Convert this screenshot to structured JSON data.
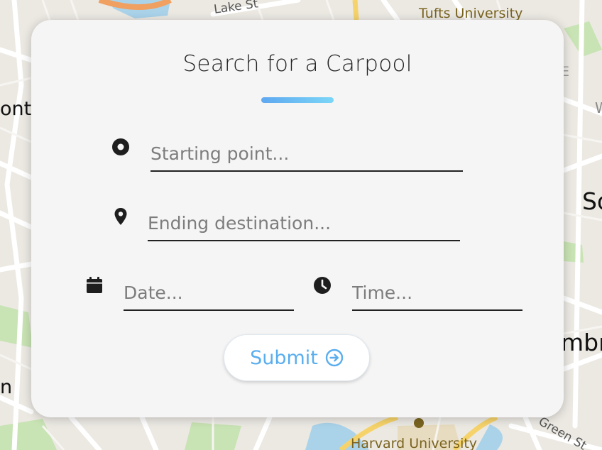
{
  "map": {
    "labels": {
      "tufts": "Tufts University",
      "lake_st": "Lake St",
      "ont": "ont",
      "so": "So",
      "mbr": "mbr",
      "n": "n",
      "w": "W",
      "e": "E",
      "harvard": "Harvard University",
      "green_st": "Green St"
    }
  },
  "form": {
    "title": "Search for a Carpool",
    "start": {
      "placeholder": "Starting point...",
      "icon": "radio-target-icon"
    },
    "end": {
      "placeholder": "Ending destination...",
      "icon": "map-pin-icon"
    },
    "date": {
      "placeholder": "Date...",
      "icon": "calendar-icon"
    },
    "time": {
      "placeholder": "Time...",
      "icon": "clock-icon"
    },
    "submit": {
      "label": "Submit",
      "icon": "arrow-circle-right-icon"
    }
  },
  "colors": {
    "accent": "#5aaeee",
    "underline_gradient_start": "#5ea8f0",
    "underline_gradient_end": "#7bd6f7",
    "card_background": "#f5f5f5"
  }
}
